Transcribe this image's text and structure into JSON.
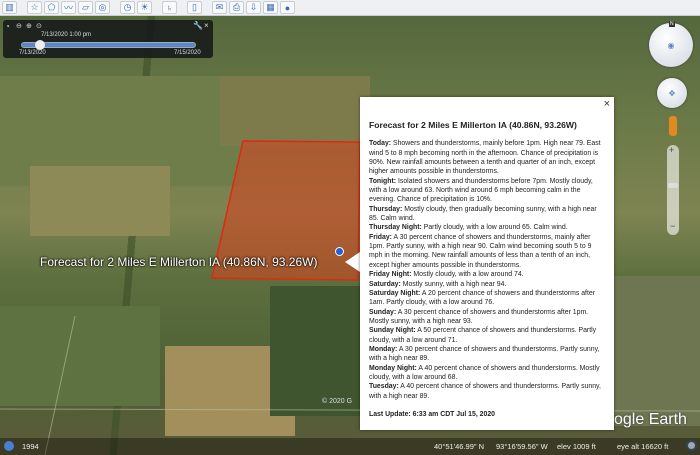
{
  "toolbar": {
    "icons": [
      "sidebar-icon",
      "placemark-icon",
      "polygon-icon",
      "path-icon",
      "overlay-icon",
      "tour-icon",
      "historical-imagery-icon",
      "sunlight-icon",
      "planets-icon",
      "ruler-icon",
      "email-icon",
      "print-icon",
      "save-image-icon",
      "maps-icon",
      "web-icon"
    ]
  },
  "time_slider": {
    "current": "7/13/2020    1:00 pm",
    "start": "7/13/2020",
    "end": "7/15/2020",
    "position": 0.08
  },
  "map": {
    "label": "Forecast for 2 Miles E Millerton IA (40.86N, 93.26W)",
    "copyright": "© 2020 G",
    "logo": "Google Earth",
    "polygon_color": "#d9411e"
  },
  "popup": {
    "title": "Forecast for 2 Miles E Millerton IA (40.86N, 93.26W)",
    "close": "×",
    "periods": [
      {
        "name": "Today:",
        "text": "Showers and thunderstorms, mainly before 1pm. High near 79. East wind 5 to 8 mph becoming north in the afternoon. Chance of precipitation is 90%. New rainfall amounts between a tenth and quarter of an inch, except higher amounts possible in thunderstorms."
      },
      {
        "name": "Tonight:",
        "text": "Isolated showers and thunderstorms before 7pm. Mostly cloudy, with a low around 63. North wind around 6 mph becoming calm in the evening. Chance of precipitation is 10%."
      },
      {
        "name": "Thursday:",
        "text": "Mostly cloudy, then gradually becoming sunny, with a high near 85. Calm wind."
      },
      {
        "name": "Thursday Night:",
        "text": "Partly cloudy, with a low around 65. Calm wind."
      },
      {
        "name": "Friday:",
        "text": "A 30 percent chance of showers and thunderstorms, mainly after 1pm. Partly sunny, with a high near 90. Calm wind becoming south 5 to 9 mph in the morning. New rainfall amounts of less than a tenth of an inch, except higher amounts possible in thunderstorms."
      },
      {
        "name": "Friday Night:",
        "text": "Mostly cloudy, with a low around 74."
      },
      {
        "name": "Saturday:",
        "text": "Mostly sunny, with a high near 94."
      },
      {
        "name": "Saturday Night:",
        "text": "A 20 percent chance of showers and thunderstorms after 1am. Partly cloudy, with a low around 76."
      },
      {
        "name": "Sunday:",
        "text": "A 30 percent chance of showers and thunderstorms after 1pm. Mostly sunny, with a high near 93."
      },
      {
        "name": "Sunday Night:",
        "text": "A 50 percent chance of showers and thunderstorms. Partly cloudy, with a low around 71."
      },
      {
        "name": "Monday:",
        "text": "A 30 percent chance of showers and thunderstorms. Partly sunny, with a high near 89."
      },
      {
        "name": "Monday Night:",
        "text": "A 40 percent chance of showers and thunderstorms. Mostly cloudy, with a low around 68."
      },
      {
        "name": "Tuesday:",
        "text": "A 40 percent chance of showers and thunderstorms. Partly sunny, with a high near 89."
      }
    ],
    "last_update": "Last Update: 6:33 am CDT Jul 15, 2020"
  },
  "status": {
    "year": "1994",
    "lat": "40°51'46.99\" N",
    "lon": "93°16'59.56\" W",
    "elev": "elev  1009 ft",
    "eye_alt": "eye alt  16620 ft"
  },
  "nav": {
    "north": "N"
  }
}
